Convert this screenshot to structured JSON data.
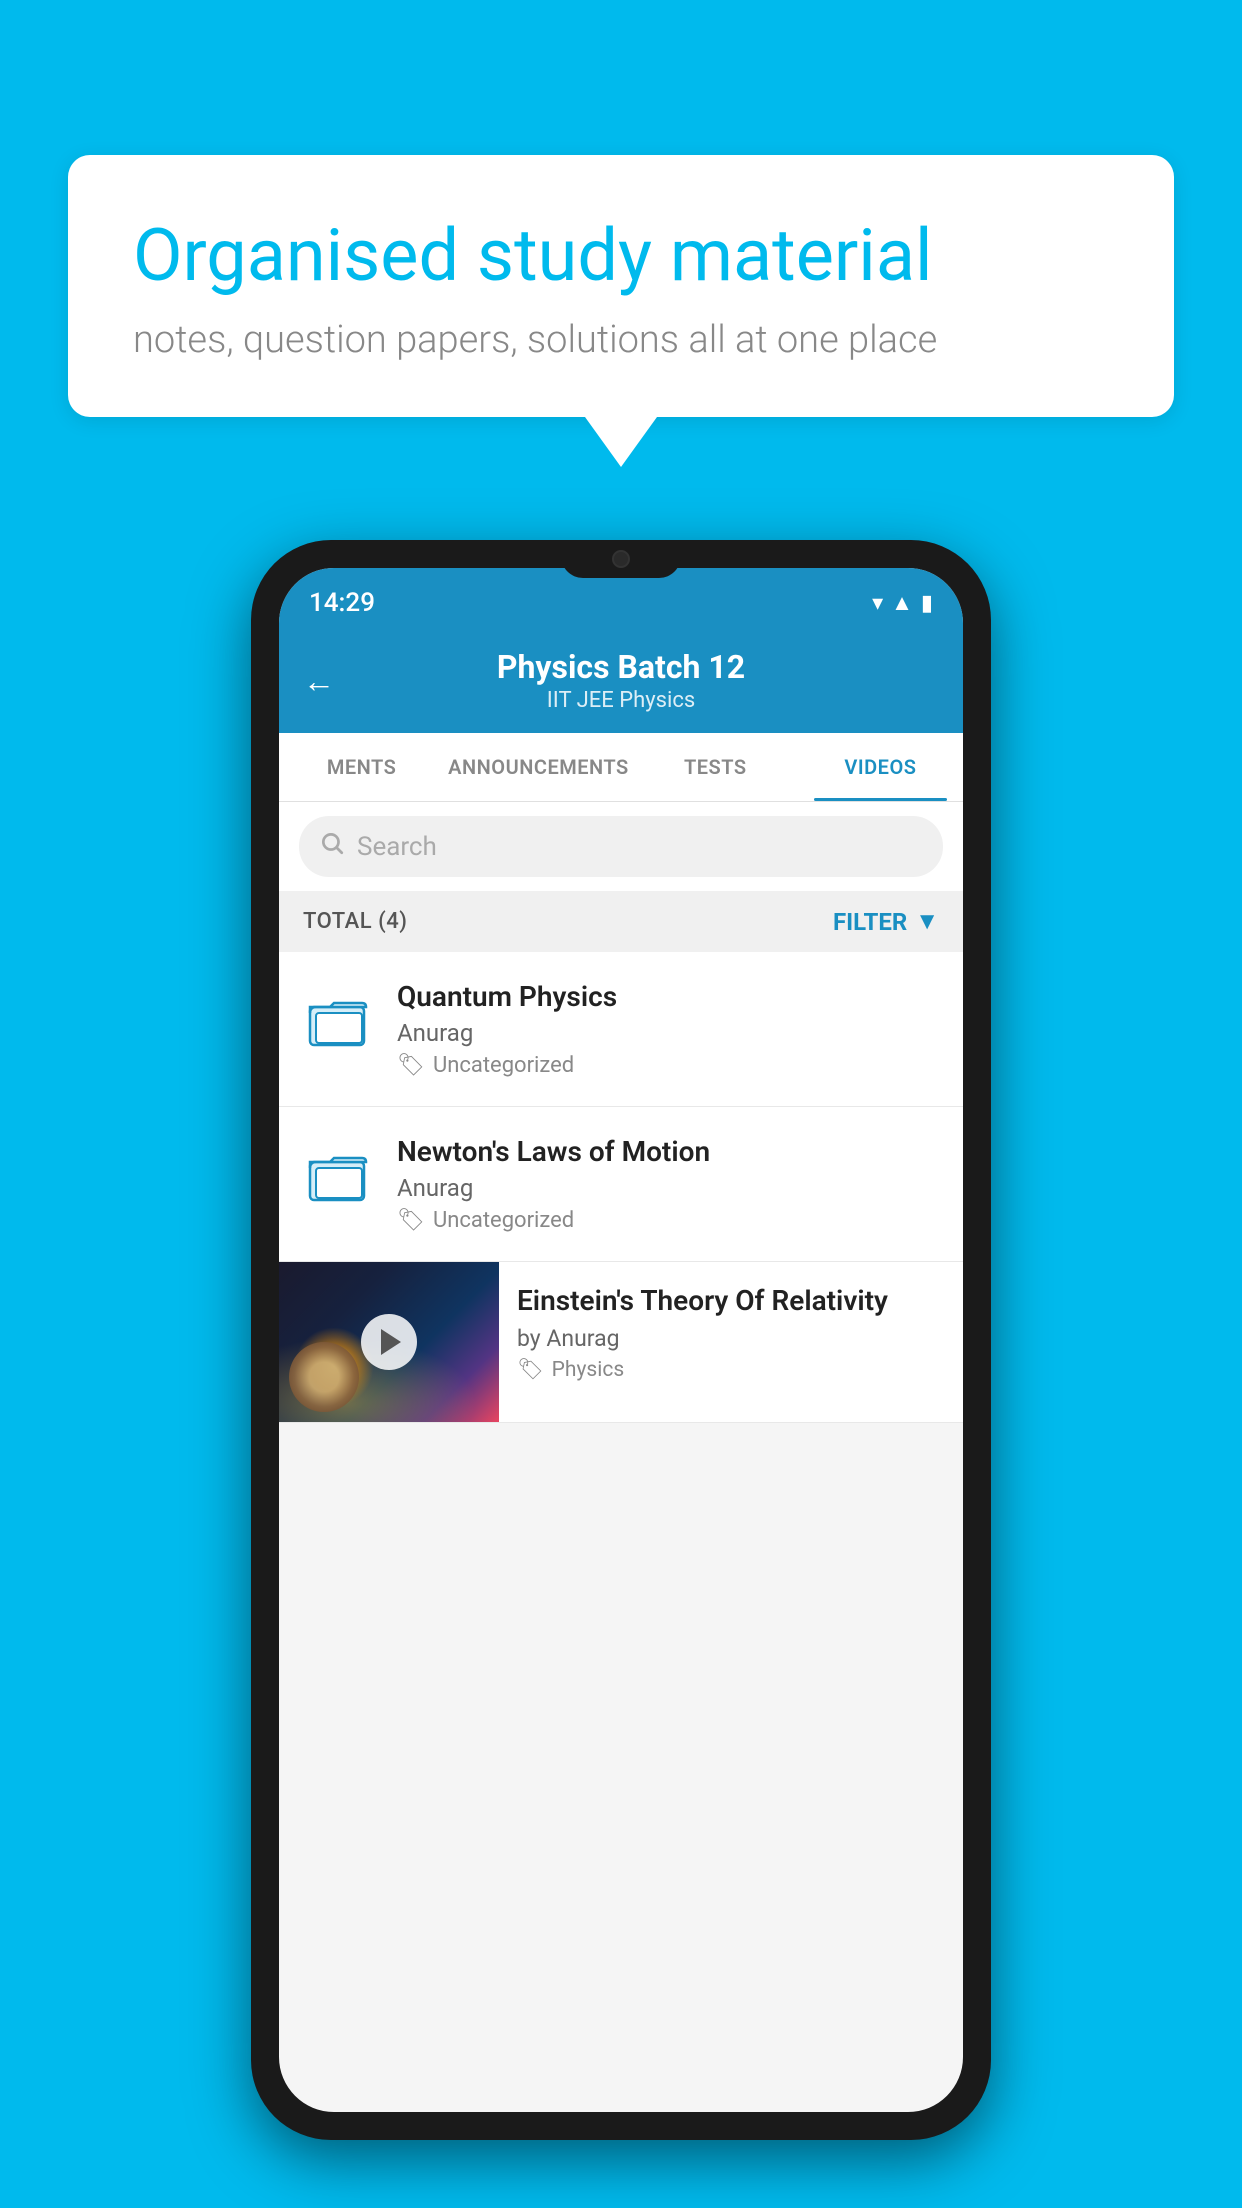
{
  "background_color": "#00BAED",
  "speech_bubble": {
    "title": "Organised study material",
    "subtitle": "notes, question papers, solutions all at one place"
  },
  "phone": {
    "status_bar": {
      "time": "14:29",
      "icons": [
        "wifi",
        "signal",
        "battery"
      ]
    },
    "header": {
      "back_label": "←",
      "title": "Physics Batch 12",
      "subtitle": "IIT JEE   Physics"
    },
    "tabs": [
      {
        "label": "MENTS",
        "active": false
      },
      {
        "label": "ANNOUNCEMENTS",
        "active": false
      },
      {
        "label": "TESTS",
        "active": false
      },
      {
        "label": "VIDEOS",
        "active": true
      }
    ],
    "search": {
      "placeholder": "Search"
    },
    "filter_bar": {
      "total_label": "TOTAL (4)",
      "filter_label": "FILTER"
    },
    "video_list": [
      {
        "id": 1,
        "type": "folder",
        "title": "Quantum Physics",
        "author": "Anurag",
        "tag": "Uncategorized"
      },
      {
        "id": 2,
        "type": "folder",
        "title": "Newton's Laws of Motion",
        "author": "Anurag",
        "tag": "Uncategorized"
      },
      {
        "id": 3,
        "type": "video",
        "title": "Einstein's Theory Of Relativity",
        "author": "by Anurag",
        "tag": "Physics"
      }
    ]
  }
}
